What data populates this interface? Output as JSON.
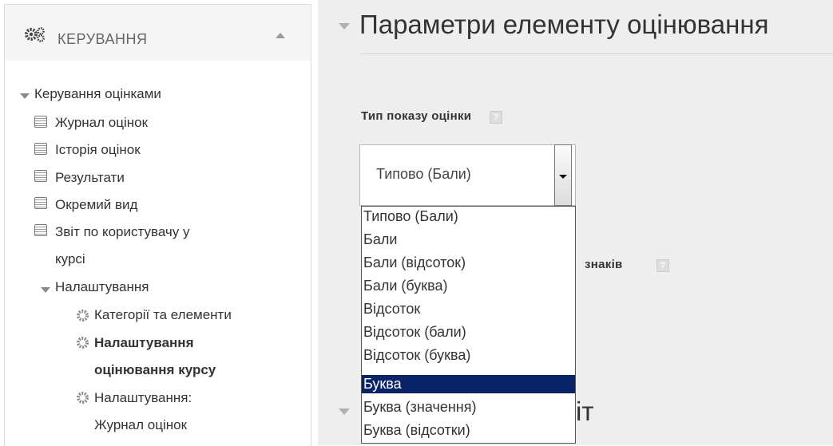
{
  "sidebar": {
    "title": "КЕРУВАННЯ",
    "items": [
      {
        "label": "Керування оцінками"
      },
      {
        "label": "Журнал оцінок"
      },
      {
        "label": "Історія оцінок"
      },
      {
        "label": "Результати"
      },
      {
        "label": "Окремий вид"
      },
      {
        "label": "Звіт по користувачу у"
      },
      {
        "label": "курсі"
      },
      {
        "label": "Налаштування"
      },
      {
        "label": "Категорії та елементи"
      },
      {
        "label": "Налаштування"
      },
      {
        "label": "оцінювання курсу"
      },
      {
        "label": "Налаштування:"
      },
      {
        "label": "Журнал оцінок"
      }
    ]
  },
  "main": {
    "section_title": "Параметри елементу оцінювання",
    "field1_label": "Тип показу оцінки",
    "help_glyph": "?",
    "select_value": "Типово (Бали)",
    "field2_label_partial": "знаків",
    "options": [
      "Типово (Бали)",
      "Бали",
      "Бали (відсоток)",
      "Бали (буква)",
      "Відсоток",
      "Відсоток (бали)",
      "Відсоток (буква)",
      "Буква",
      "Буква (значення)",
      "Буква (відсотки)"
    ],
    "selected_option": "Буква",
    "second_section_partial": "іт"
  }
}
